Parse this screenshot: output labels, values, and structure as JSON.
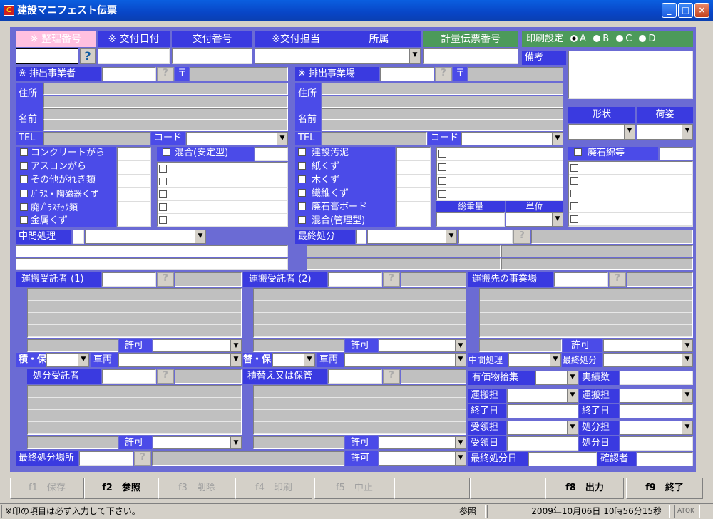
{
  "window": {
    "title": "建設マニフェスト伝票",
    "icon_glyph": "C",
    "minimize": "_",
    "maximize": "□",
    "close": "×"
  },
  "header": {
    "seiri": "※ 整理番号",
    "kofu_date": "※ 交付日付",
    "kofu_no": "交付番号",
    "kofu_tanto": "※交付担当",
    "shozoku": "所属",
    "keiryo": "計量伝票番号",
    "print_label": "印刷設定",
    "print_options": [
      "A",
      "B",
      "C",
      "D"
    ],
    "print_selected": "A",
    "help": "?",
    "biko": "備考"
  },
  "haishutsu_jigyosha": {
    "label": "※ 排出事業者",
    "zip": "〒",
    "address": "住所",
    "name": "名前",
    "tel": "TEL",
    "code": "コード"
  },
  "haishutsu_jigyojo": {
    "label": "※ 排出事業場",
    "zip": "〒",
    "address": "住所",
    "name": "名前",
    "tel": "TEL",
    "code": "コード"
  },
  "keijo": {
    "shape": "形状",
    "nisugata": "荷姿"
  },
  "waste_a": [
    "コンクリートがら",
    "アスコンがら",
    "その他がれき類",
    "ｶﾞﾗｽ・陶磁器くず",
    "廃ﾌﾟﾗｽﾁｯｸ類",
    "金属くず"
  ],
  "mixed_stable": "混合(安定型)",
  "waste_b": [
    "建設汚泥",
    "紙くず",
    "木くず",
    "繊維くず",
    "廃石膏ボード",
    "混合(管理型)"
  ],
  "asbestos": "廃石綿等",
  "total": {
    "weight": "総重量",
    "unit": "単位"
  },
  "chukan": "中間処理",
  "saishu": "最終処分",
  "unpan1": "運搬受託者 (1)",
  "unpan2": "運搬受託者 (2)",
  "unpan_dest": "運搬先の事業場",
  "kyoka": "許可",
  "tsumi_ho": "積・保",
  "kae_ho": "替・保",
  "sharyo": "車両",
  "chukan_shori": "中間処理",
  "saishu_shobun": "最終処分",
  "shobun_jutaku": "処分受託者",
  "tsumikae": "積替え又は保管",
  "yuka": "有価物拾集",
  "jisseki": "実績数",
  "unpan_tan": "運搬担",
  "shuryo": "終了日",
  "juryo_tan": "受領担",
  "juryo_bi": "受領日",
  "shobun_tan": "処分担",
  "shobun_bi": "処分日",
  "saishu_basho": "最終処分場所",
  "saishu_bi": "最終処分日",
  "kakuninsha": "確認者",
  "fkeys": [
    {
      "key": "f1",
      "label": "保存",
      "on": false
    },
    {
      "key": "f2",
      "label": "参照",
      "on": true
    },
    {
      "key": "f3",
      "label": "削除",
      "on": false
    },
    {
      "key": "f4",
      "label": "印刷",
      "on": false
    },
    {
      "key": "f5",
      "label": "中止",
      "on": false
    },
    {
      "key": "f8",
      "label": "出力",
      "on": true
    },
    {
      "key": "f9",
      "label": "終了",
      "on": true
    }
  ],
  "status": {
    "message": "※印の項目は必ず入力して下さい。",
    "mode": "参照",
    "datetime": "2009年10月06日 10時56分15秒",
    "ime": "ATOK"
  }
}
